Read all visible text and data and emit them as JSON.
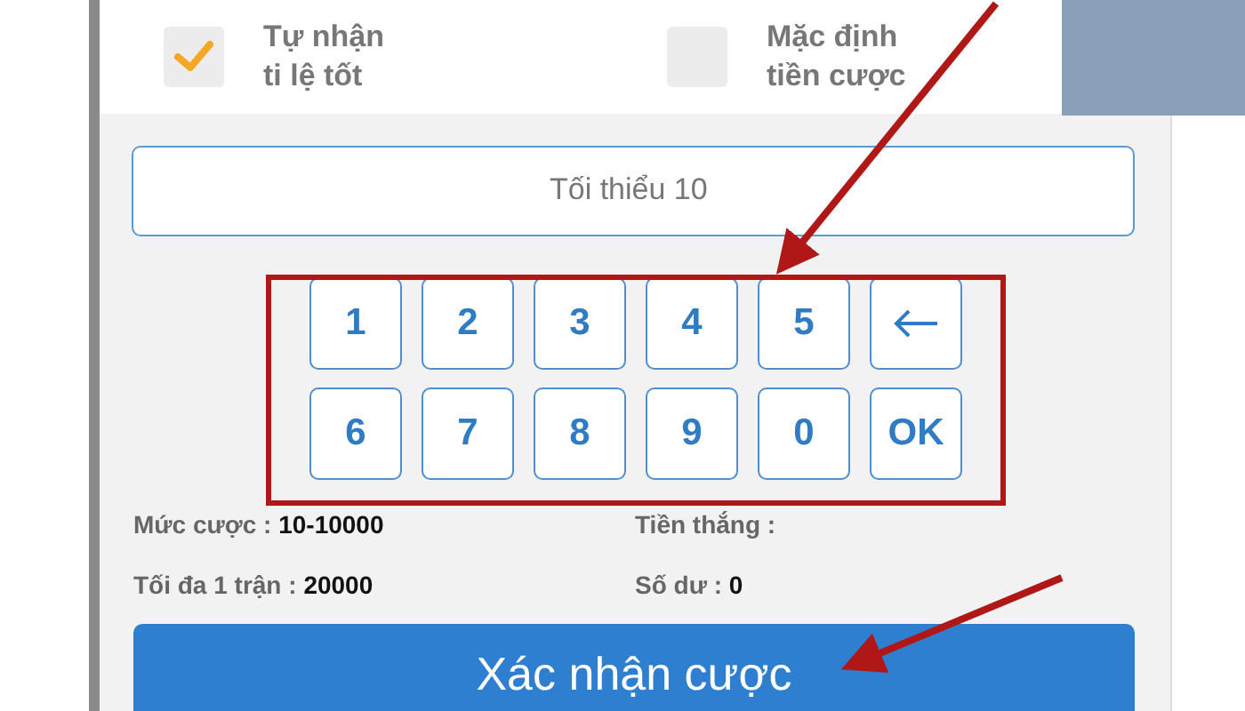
{
  "options": [
    {
      "label": "Tự nhận\nti lệ tốt",
      "checked": true
    },
    {
      "label": "Mặc định\ntiền cược",
      "checked": false
    }
  ],
  "amount_field": {
    "placeholder": "Tối thiểu 10"
  },
  "keypad": [
    {
      "kind": "digit",
      "label": "1"
    },
    {
      "kind": "digit",
      "label": "2"
    },
    {
      "kind": "digit",
      "label": "3"
    },
    {
      "kind": "digit",
      "label": "4"
    },
    {
      "kind": "digit",
      "label": "5"
    },
    {
      "kind": "backspace"
    },
    {
      "kind": "digit",
      "label": "6"
    },
    {
      "kind": "digit",
      "label": "7"
    },
    {
      "kind": "digit",
      "label": "8"
    },
    {
      "kind": "digit",
      "label": "9"
    },
    {
      "kind": "digit",
      "label": "0"
    },
    {
      "kind": "digit",
      "label": "OK"
    }
  ],
  "info": [
    {
      "label": "Mức cược :",
      "value": "10-10000"
    },
    {
      "label": "Tiền thắng :"
    },
    {
      "label": "Tối đa 1 trận :",
      "value": "20000"
    },
    {
      "label": "Số dư :",
      "value": "0"
    }
  ],
  "confirm_button": "Xác nhận cược"
}
